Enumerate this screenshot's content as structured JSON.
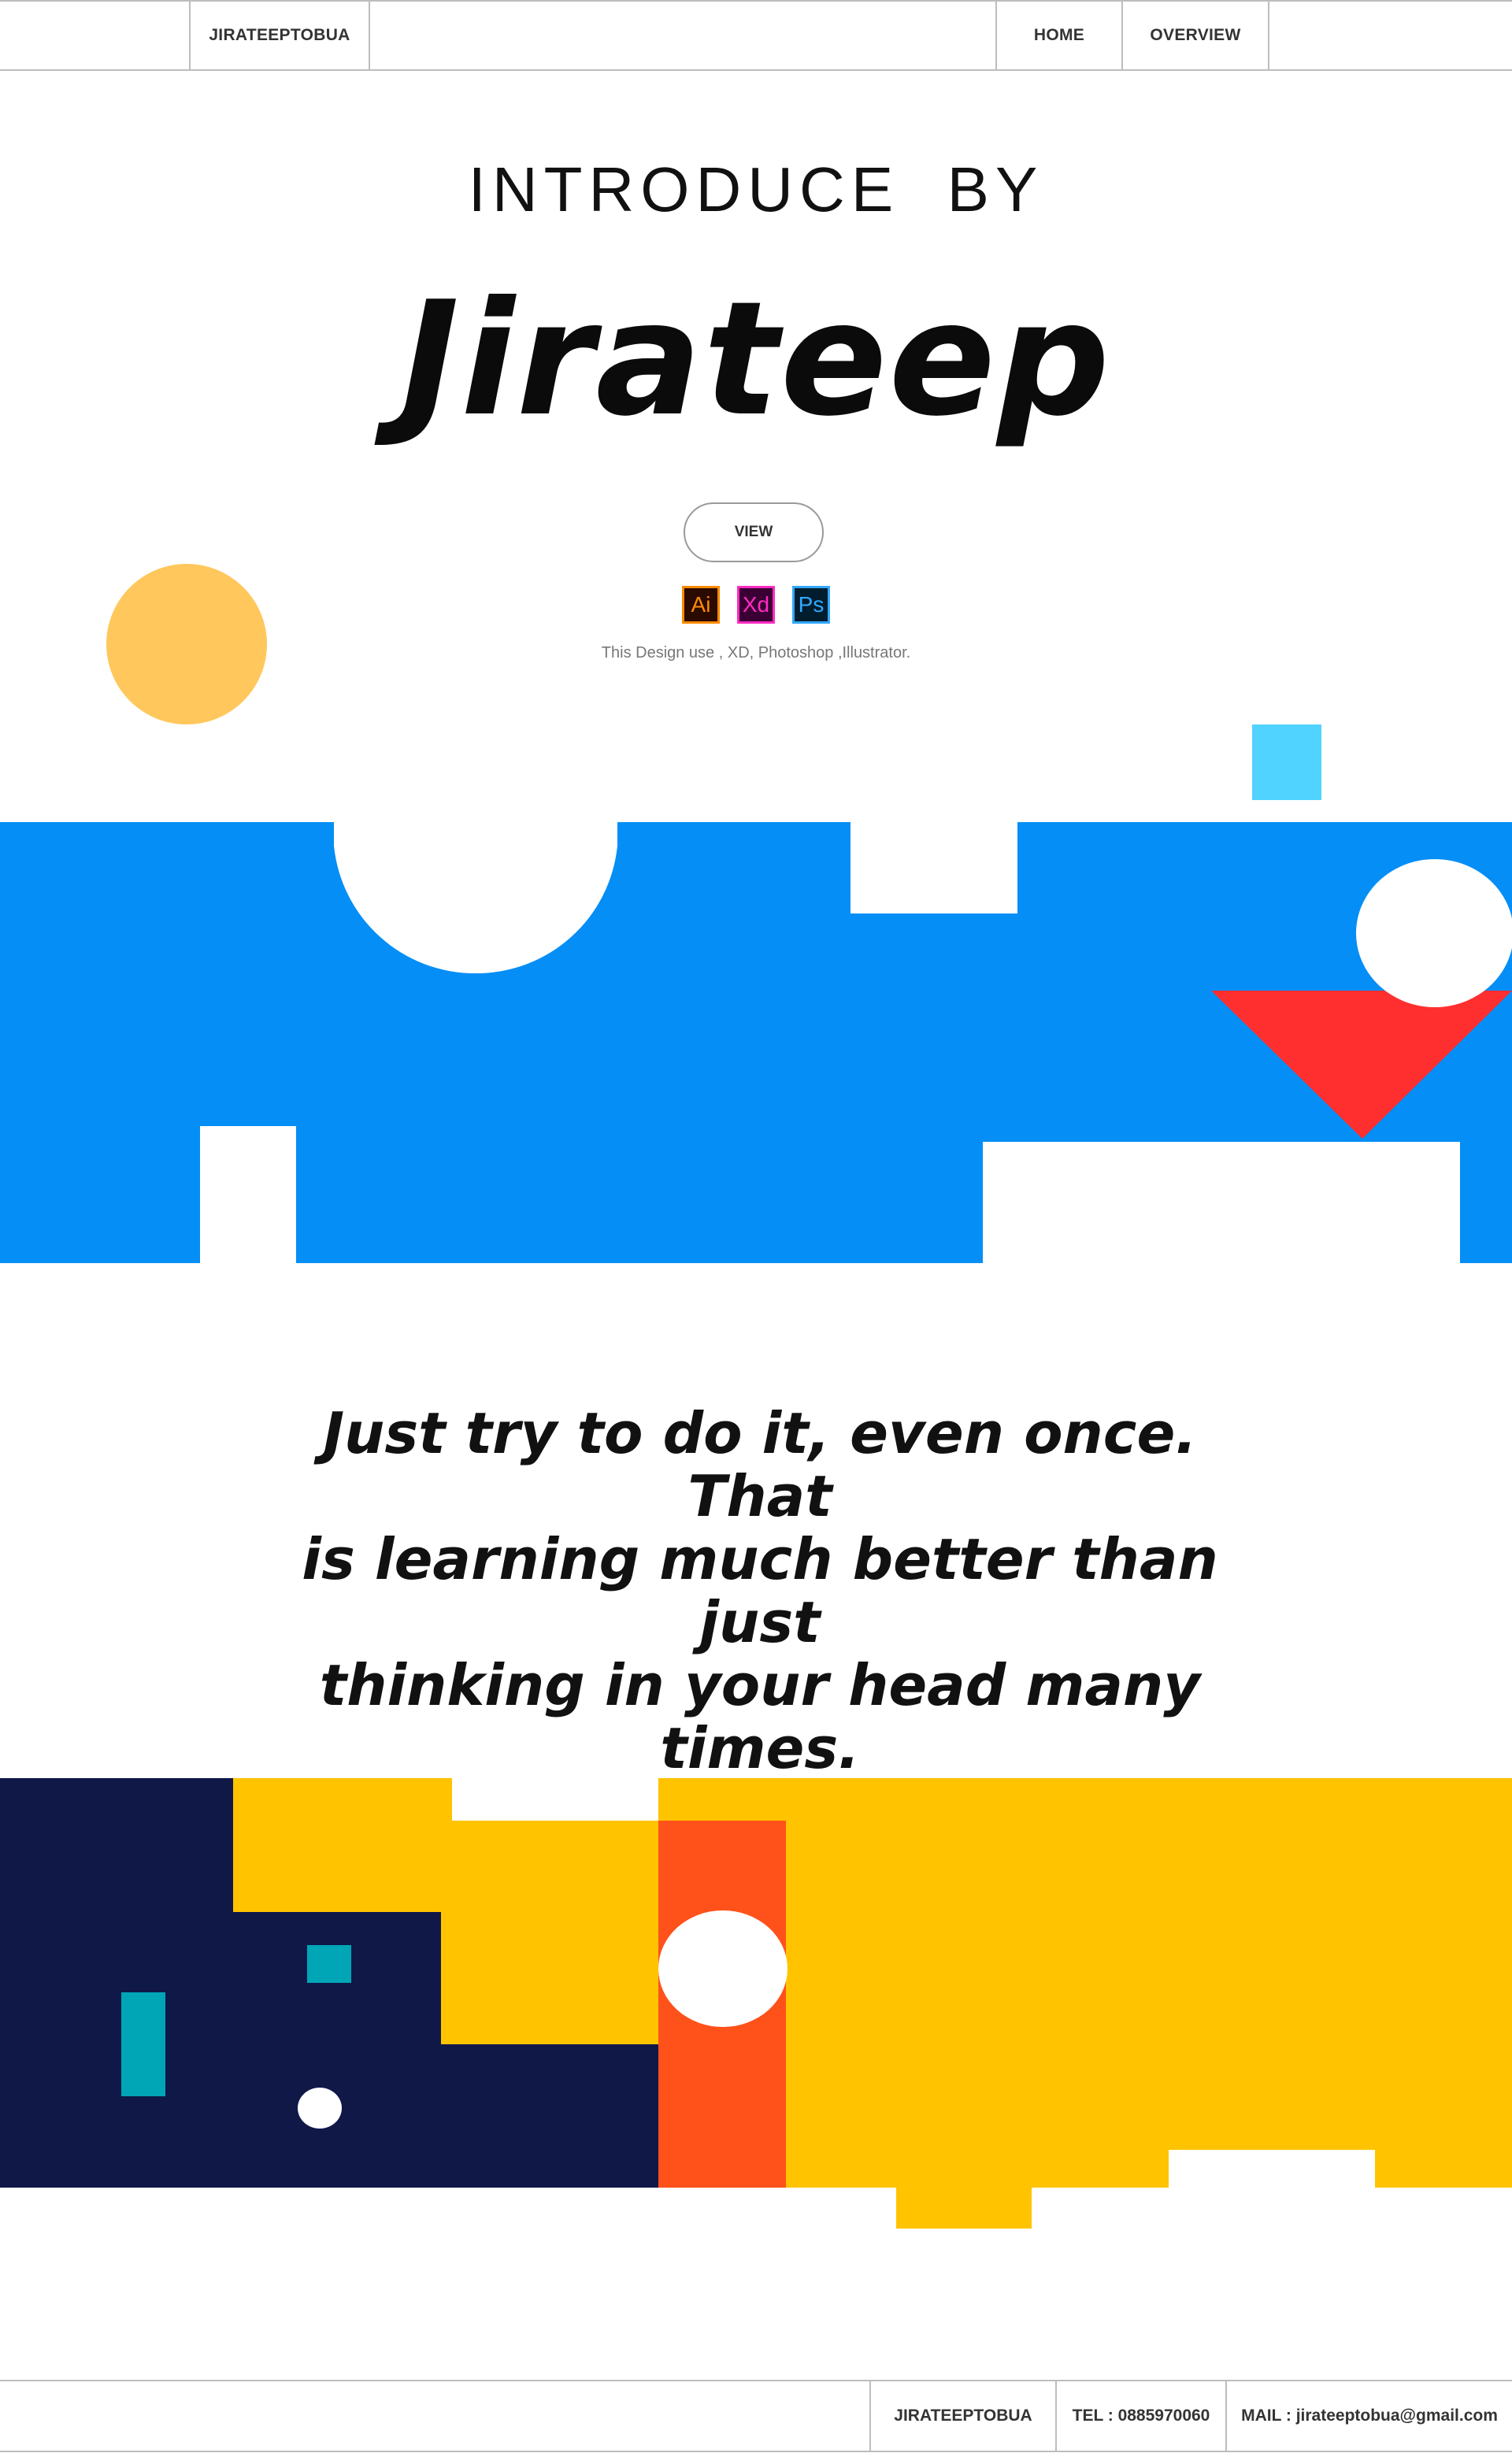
{
  "header": {
    "brand": "JIRATEEPTOBUA",
    "nav": [
      {
        "label": "HOME"
      },
      {
        "label": "OVERVIEW"
      }
    ]
  },
  "hero": {
    "kicker": "INTRODUCE  BY",
    "name": "Jirateep",
    "view_label": "VIEW",
    "tools": [
      {
        "abbr": "Ai",
        "icon": "illustrator-icon",
        "bg": "#2b0a00",
        "fg": "#ff8a00"
      },
      {
        "abbr": "Xd",
        "icon": "xd-icon",
        "bg": "#3a0034",
        "fg": "#ff2bc2"
      },
      {
        "abbr": "Ps",
        "icon": "photoshop-icon",
        "bg": "#001d2e",
        "fg": "#31a8ff"
      }
    ],
    "design_note": "This Design use , XD, Photoshop ,Illustrator."
  },
  "quote": {
    "lines": [
      "Just try to do it, even once. That",
      "is learning much better than just",
      "thinking in your head many times."
    ]
  },
  "footer": {
    "brand": "JIRATEEPTOBUA",
    "tel": "TEL : 0885970060",
    "mail": "MAIL : jirateeptobua@gmail.com"
  },
  "colors": {
    "blue_band": "#058ef6",
    "red_triangle": "#ff2f2f",
    "cyan_square": "#51d3ff",
    "orange_circle": "#ffc75c",
    "navy": "#101848",
    "yellow": "#ffc300",
    "orange_red": "#ff511a",
    "teal": "#00a6b6"
  }
}
